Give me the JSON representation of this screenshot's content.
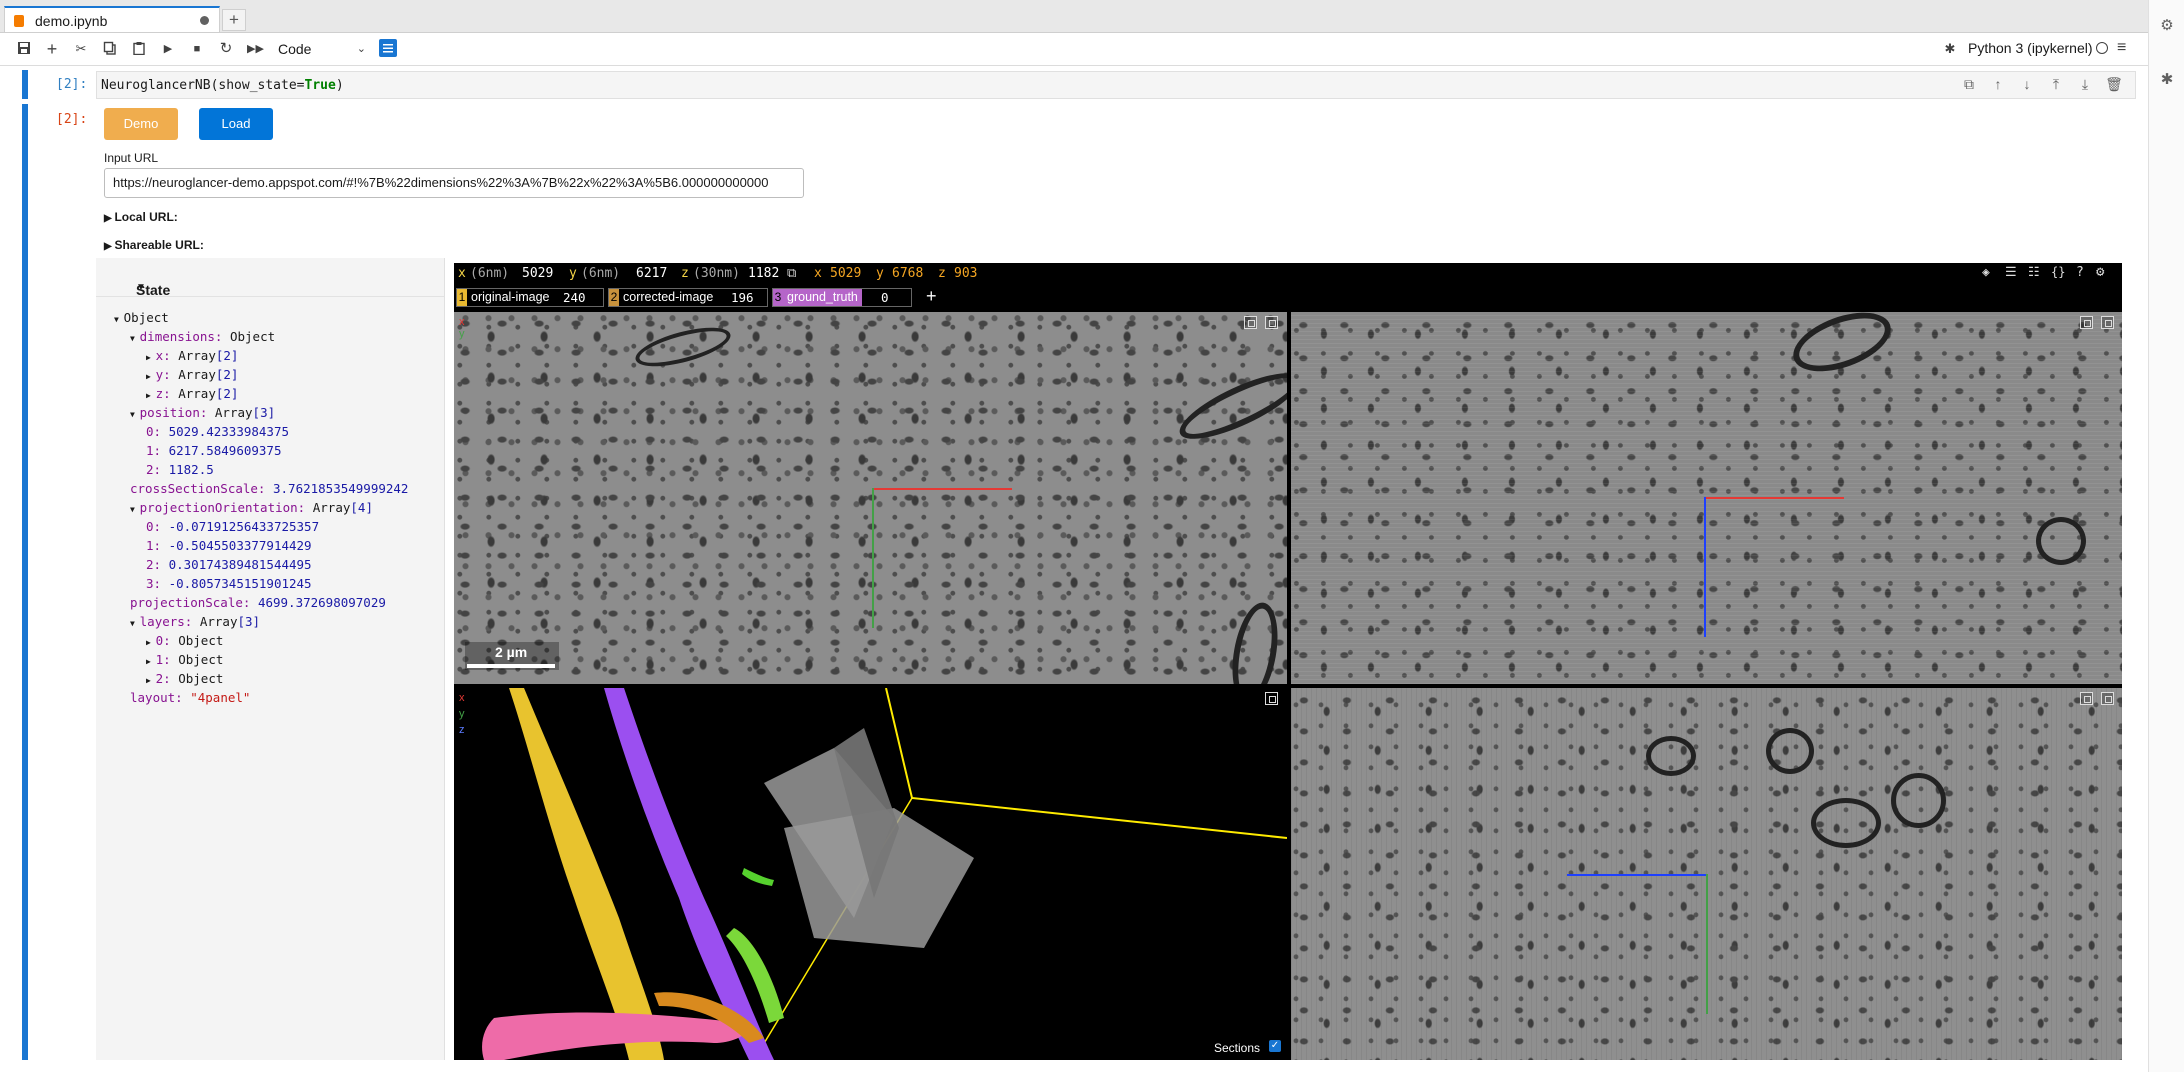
{
  "tab": {
    "title": "demo.ipynb",
    "new_tab": "+"
  },
  "toolbar": {
    "cell_type": "Code",
    "kernel": "Python 3 (ipykernel)"
  },
  "cells": {
    "in_prompt": "[2]:",
    "out_prompt": "[2]:",
    "code_call": "NeuroglancerNB(show_state=",
    "code_kw": "True",
    "code_close": ")"
  },
  "output": {
    "demo_label": "Demo",
    "load_label": "Load",
    "input_url_label": "Input URL",
    "input_url_value": "https://neuroglancer-demo.appspot.com/#!%7B%22dimensions%22%3A%7B%22x%22%3A%5B6.000000000000",
    "local_url": "Local URL:",
    "shareable_url": "Shareable URL:"
  },
  "state": {
    "header": "State",
    "root": "Object",
    "dimensions_key": "dimensions:",
    "dimensions_val": "Object",
    "dim_x_key": "x:",
    "dim_x_val": "Array",
    "dim_x_len": "[2]",
    "dim_y_key": "y:",
    "dim_y_val": "Array",
    "dim_y_len": "[2]",
    "dim_z_key": "z:",
    "dim_z_val": "Array",
    "dim_z_len": "[2]",
    "position_key": "position:",
    "position_val": "Array",
    "position_len": "[3]",
    "pos0_key": "0:",
    "pos0_val": "5029.42333984375",
    "pos1_key": "1:",
    "pos1_val": "6217.5849609375",
    "pos2_key": "2:",
    "pos2_val": "1182.5",
    "cross_key": "crossSectionScale:",
    "cross_val": "3.7621853549999242",
    "po_key": "projectionOrientation:",
    "po_val": "Array",
    "po_len": "[4]",
    "po0_key": "0:",
    "po0_val": "-0.07191256433725357",
    "po1_key": "1:",
    "po1_val": "-0.5045503377914429",
    "po2_key": "2:",
    "po2_val": "0.30174389481544495",
    "po3_key": "3:",
    "po3_val": "-0.8057345151901245",
    "ps_key": "projectionScale:",
    "ps_val": "4699.372698097029",
    "layers_key": "layers:",
    "layers_val": "Array",
    "layers_len": "[3]",
    "l0_key": "0:",
    "l0_val": "Object",
    "l1_key": "1:",
    "l1_val": "Object",
    "l2_key": "2:",
    "l2_val": "Object",
    "layout_key": "layout:",
    "layout_val": "\"4panel\""
  },
  "viewer": {
    "x_label": "x",
    "x_unit": "(6nm)",
    "x_val": "5029",
    "y_label": "y",
    "y_unit": "(6nm)",
    "y_val": "6217",
    "z_label": "z",
    "z_unit": "(30nm)",
    "z_val": "1182",
    "mouse_x_label": "x",
    "mouse_x_val": "5029",
    "mouse_y_label": "y",
    "mouse_y_val": "6768",
    "mouse_z_label": "z",
    "mouse_z_val": "903",
    "layers": [
      {
        "num": "1",
        "name": "original-image",
        "value": "240"
      },
      {
        "num": "2",
        "name": "corrected-image",
        "value": "196"
      },
      {
        "num": "3",
        "name": "ground_truth",
        "value": "0"
      }
    ],
    "add_layer": "+",
    "scale_bar": "2 µm",
    "axis_x": "x",
    "axis_y": "y",
    "axis_z": "z",
    "sections_label": "Sections",
    "icon_braces": "{}",
    "icon_help": "?"
  },
  "colors": {
    "accent": "#1976d2",
    "demo_button": "#f0ad4e",
    "load_button": "#0275d8",
    "layer1": "#e8b931",
    "layer2": "#c8923c",
    "layer3": "#b565c9",
    "pos_label": "#f5d547",
    "mouse_pos": "#f5a623"
  }
}
